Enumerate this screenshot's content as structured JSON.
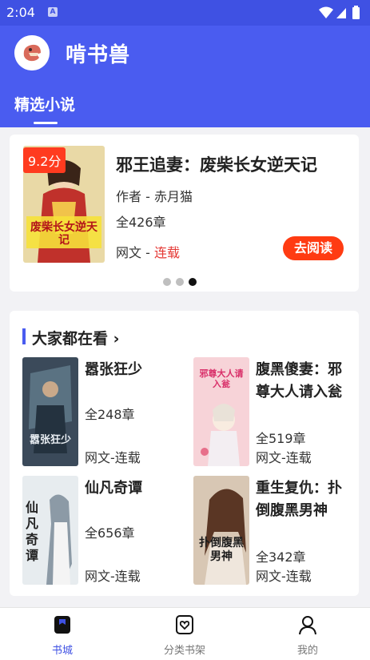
{
  "status": {
    "time": "2:04"
  },
  "app": {
    "title": "啃书兽",
    "tab": "精选小说"
  },
  "featured": {
    "rating": "9.2分",
    "title": "邪王追妻：废柴长女逆天记",
    "author": "作者 - 赤月猫",
    "chapters": "全426章",
    "type_prefix": "网文 - ",
    "status": "连载",
    "read_button": "去阅读",
    "cover_text": "废柴长女逆天记"
  },
  "section": {
    "title": "大家都在看 ›"
  },
  "books": [
    {
      "name": "嚣张狂少",
      "chapters": "全248章",
      "kind": "网文-连载",
      "cover_text": "嚣张狂少"
    },
    {
      "name": "腹黑傻妻：邪尊大人请入瓮",
      "chapters": "全519章",
      "kind": "网文-连载",
      "cover_text": "邪尊大人请入瓮"
    },
    {
      "name": "仙凡奇谭",
      "chapters": "全656章",
      "kind": "网文-连载",
      "cover_text": "仙凡奇谭"
    },
    {
      "name": "重生复仇：扑倒腹黑男神",
      "chapters": "全342章",
      "kind": "网文-连载",
      "cover_text": "扑倒腹黑男神"
    }
  ],
  "nav": [
    {
      "label": "书城"
    },
    {
      "label": "分类书架"
    },
    {
      "label": "我的"
    }
  ]
}
